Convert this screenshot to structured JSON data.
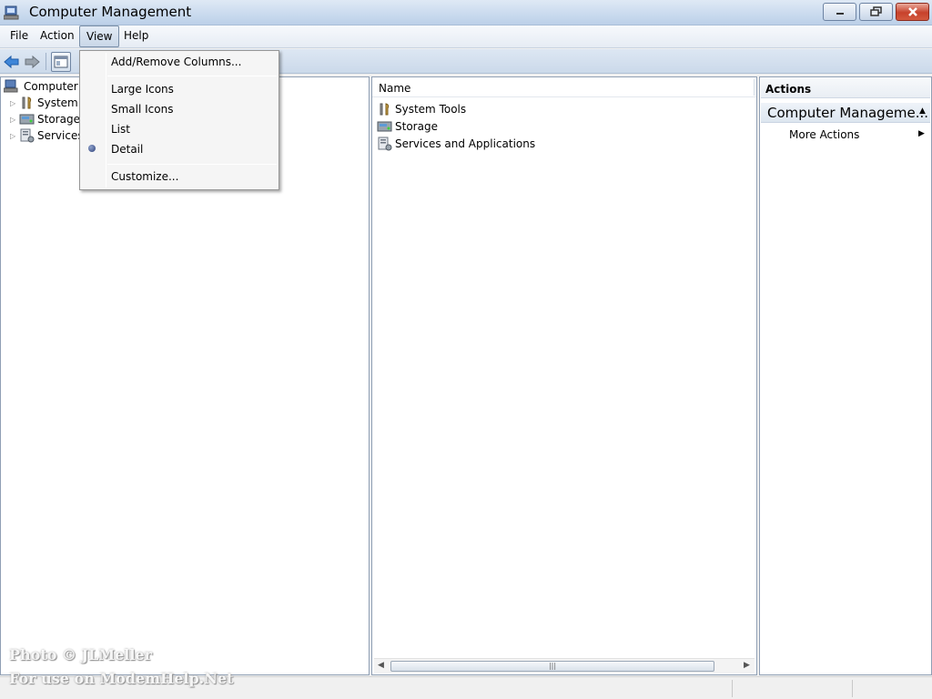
{
  "window": {
    "title": "Computer Management",
    "buttons": {
      "minimize": "minimize",
      "maximize": "restore",
      "close": "close"
    }
  },
  "menubar": {
    "items": [
      "File",
      "Action",
      "View",
      "Help"
    ],
    "active": "View"
  },
  "view_menu": {
    "items": [
      "Add/Remove Columns...",
      "Large Icons",
      "Small Icons",
      "List",
      "Detail",
      "Customize..."
    ],
    "selected": "Detail"
  },
  "tree": {
    "root": "Computer M",
    "items": [
      "System",
      "Storage",
      "Services"
    ]
  },
  "list": {
    "column_header": "Name",
    "rows": [
      "System Tools",
      "Storage",
      "Services and Applications"
    ]
  },
  "actions": {
    "header": "Actions",
    "group_title": "Computer Manageme...",
    "more_actions": "More Actions"
  },
  "watermark": {
    "line1": "Photo © JLMeller",
    "line2": "For use on ModemHelp.Net"
  },
  "colors": {
    "title_bar": "#c9daee",
    "close_button": "#c7412b",
    "pane_border": "#8f9fb4",
    "radio_bullet": "#2d3f78"
  },
  "icons": {
    "app": "computer-management-icon",
    "back": "back-arrow-icon",
    "forward": "forward-arrow-icon",
    "show_hide_tree": "console-tree-icon",
    "system_tools": "tools-icon",
    "storage": "storage-icon",
    "services": "services-icon"
  }
}
